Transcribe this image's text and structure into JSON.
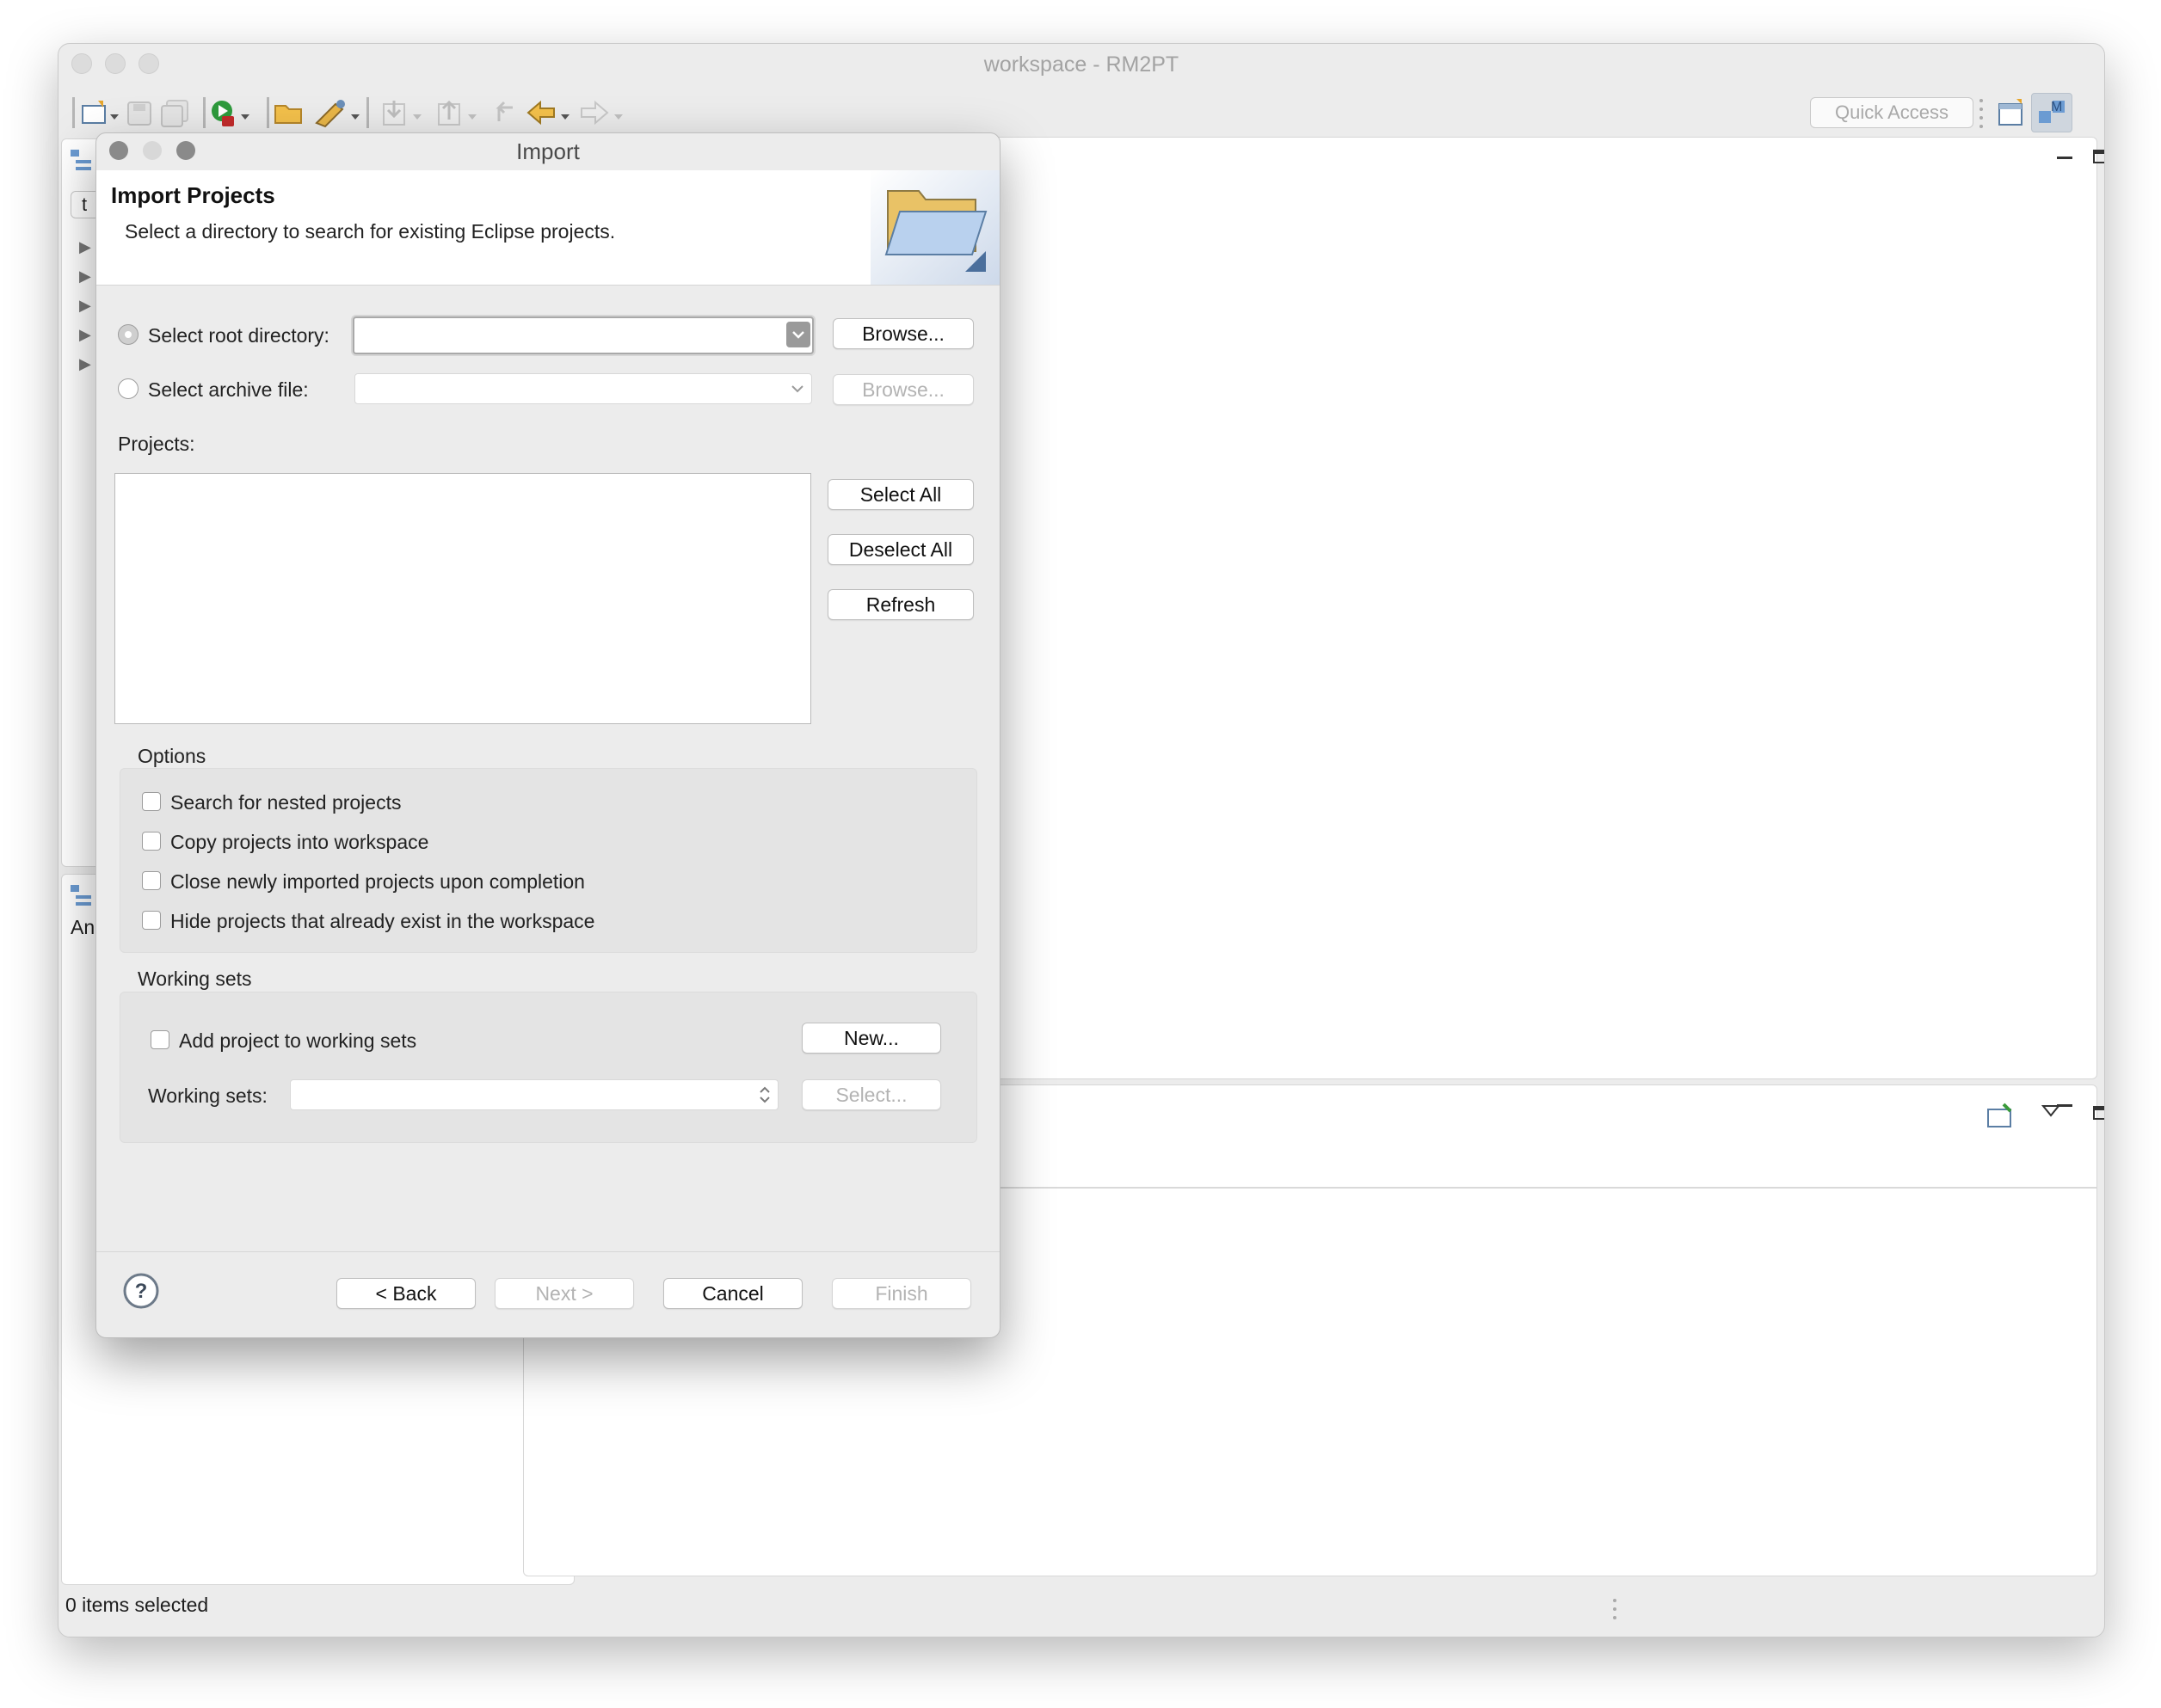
{
  "window": {
    "title": "workspace - RM2PT"
  },
  "toolbar": {
    "quick_access_placeholder": "Quick Access"
  },
  "left_panel": {
    "tab_fragment": "t",
    "analysis_label_fragment": "An"
  },
  "status_bar": {
    "text": "0 items selected"
  },
  "dialog": {
    "title": "Import",
    "header_title": "Import Projects",
    "header_description": "Select a directory to search for existing Eclipse projects.",
    "root_dir_label": "Select root directory:",
    "root_dir_value": "",
    "archive_label": "Select archive file:",
    "archive_value": "",
    "browse_label": "Browse...",
    "browse_archive_label": "Browse...",
    "projects_label": "Projects:",
    "projects": [],
    "select_all": "Select All",
    "deselect_all": "Deselect All",
    "refresh": "Refresh",
    "options_title": "Options",
    "options": [
      "Search for nested projects",
      "Copy projects into workspace",
      "Close newly imported projects upon completion",
      "Hide projects that already exist in the workspace"
    ],
    "working_sets_title": "Working sets",
    "add_to_working_sets": "Add project to working sets",
    "new_button": "New...",
    "working_sets_label": "Working sets:",
    "select_button": "Select...",
    "back": "< Back",
    "next": "Next >",
    "cancel": "Cancel",
    "finish": "Finish"
  },
  "icons": [
    "new-wizard-icon",
    "save-icon",
    "save-all-icon",
    "run-icon",
    "open-icon",
    "build-icon",
    "import-icon",
    "export-icon",
    "back-nav-icon",
    "forward-nav-icon",
    "perspective-icon",
    "model-perspective-icon",
    "minimize-icon",
    "maximize-icon",
    "folder-icon",
    "help-icon"
  ]
}
